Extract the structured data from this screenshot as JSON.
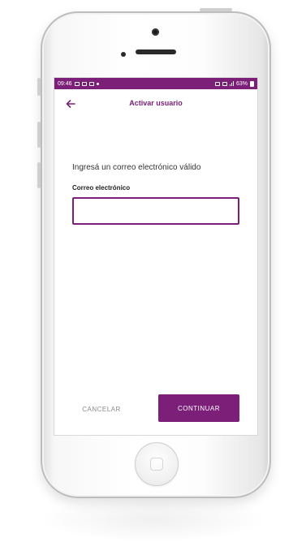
{
  "status_bar": {
    "time": "09:46",
    "battery": "63%"
  },
  "app_bar": {
    "title": "Activar usuario",
    "back_icon": "arrow-left-icon"
  },
  "form": {
    "prompt": "Ingresá un correo electrónico válido",
    "email_label": "Correo electrónico",
    "email_value": "",
    "email_placeholder": ""
  },
  "actions": {
    "cancel_label": "CANCELAR",
    "continue_label": "CONTINUAR"
  },
  "colors": {
    "primary": "#7b1f78",
    "cancel_text": "#8a8a8a"
  }
}
